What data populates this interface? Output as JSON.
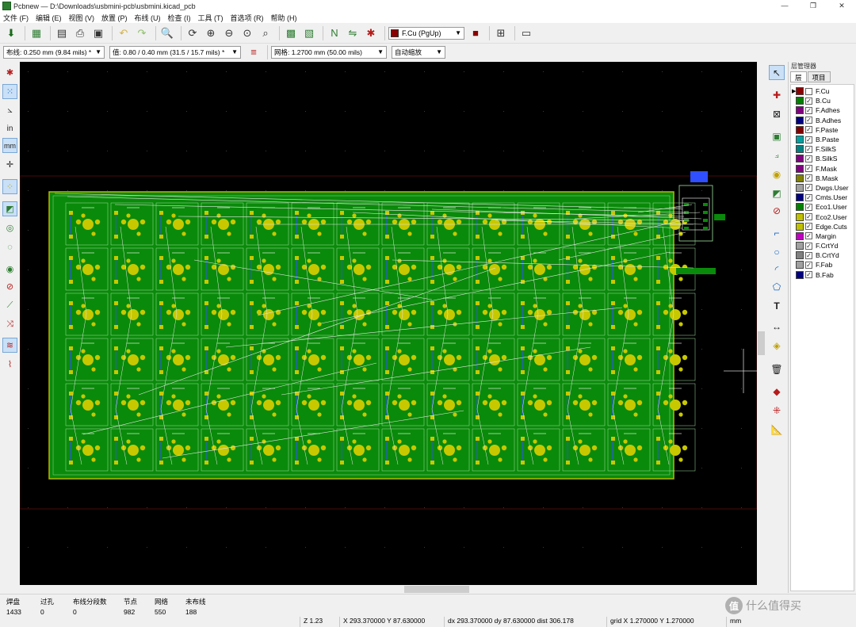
{
  "window": {
    "title": "Pcbnew — D:\\Downloads\\usbmini-pcb\\usbmini.kicad_pcb",
    "controls": [
      "—",
      "❐",
      "✕"
    ]
  },
  "menu": [
    "文件 (F)",
    "编辑 (E)",
    "视图 (V)",
    "放置 (P)",
    "布线 (U)",
    "检查 (I)",
    "工具 (T)",
    "首选项 (R)",
    "帮助 (H)"
  ],
  "toolbar": {
    "layer_selector": "F.Cu (PgUp)",
    "layer_color": "#8b0000"
  },
  "toolbar2": {
    "track_width": "布线: 0.250 mm (9.84 mils) *",
    "via_size": "值: 0.80 / 0.40 mm (31.5 / 15.7 mils) *",
    "grid": "网格: 1.2700 mm (50.00 mils)",
    "zoom": "自动缩放"
  },
  "left_tools": {
    "inch_label": "in",
    "mm_label": "mm"
  },
  "layer_manager": {
    "title": "层管理器",
    "tabs": [
      "层",
      "项目"
    ],
    "layers": [
      {
        "name": "F.Cu",
        "color": "#8b0000",
        "checked": false,
        "active": true
      },
      {
        "name": "B.Cu",
        "color": "#008000",
        "checked": true
      },
      {
        "name": "F.Adhes",
        "color": "#800080",
        "checked": true
      },
      {
        "name": "B.Adhes",
        "color": "#000080",
        "checked": true
      },
      {
        "name": "F.Paste",
        "color": "#800000",
        "checked": true
      },
      {
        "name": "B.Paste",
        "color": "#00a0a0",
        "checked": true
      },
      {
        "name": "F.SilkS",
        "color": "#008080",
        "checked": true
      },
      {
        "name": "B.SilkS",
        "color": "#800080",
        "checked": true
      },
      {
        "name": "F.Mask",
        "color": "#800080",
        "checked": true
      },
      {
        "name": "B.Mask",
        "color": "#808000",
        "checked": true
      },
      {
        "name": "Dwgs.User",
        "color": "#a0a0a0",
        "checked": true
      },
      {
        "name": "Cmts.User",
        "color": "#000080",
        "checked": true
      },
      {
        "name": "Eco1.User",
        "color": "#008000",
        "checked": true
      },
      {
        "name": "Eco2.User",
        "color": "#c0c000",
        "checked": true
      },
      {
        "name": "Edge.Cuts",
        "color": "#c0c000",
        "checked": true
      },
      {
        "name": "Margin",
        "color": "#c000c0",
        "checked": true
      },
      {
        "name": "F.CrtYd",
        "color": "#a0a0a0",
        "checked": true
      },
      {
        "name": "B.CrtYd",
        "color": "#808080",
        "checked": true
      },
      {
        "name": "F.Fab",
        "color": "#a0a0a0",
        "checked": true
      },
      {
        "name": "B.Fab",
        "color": "#000080",
        "checked": true
      }
    ]
  },
  "status": {
    "pads_label": "焊盘",
    "pads": "1433",
    "vias_label": "过孔",
    "vias": "0",
    "track_segments_label": "布线分段数",
    "track_segments": "0",
    "nodes_label": "节点",
    "nodes": "982",
    "nets_label": "网络",
    "nets": "550",
    "unrouted_label": "未布线",
    "unrouted": "188",
    "zoom": "Z 1.23",
    "xy": "X 293.370000  Y 87.630000",
    "dxy": "dx 293.370000  dy 87.630000  dist 306.178",
    "grid": "grid X 1.270000  Y 1.270000",
    "units": "mm"
  },
  "watermark": {
    "badge": "值",
    "text": "什么值得买"
  }
}
